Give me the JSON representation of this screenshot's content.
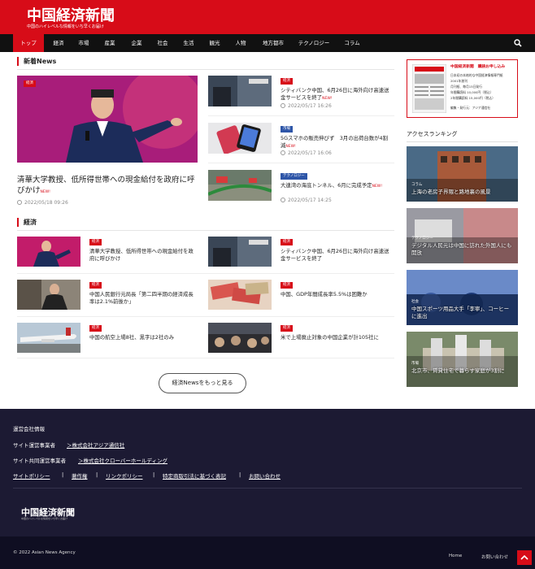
{
  "header": {
    "logo": "中国経済新聞",
    "tagline": "中国のハイレベルな情報をいち早くお届け"
  },
  "nav": {
    "items": [
      "トップ",
      "経済",
      "市場",
      "産業",
      "企業",
      "社会",
      "生活",
      "観光",
      "人物",
      "地方都市",
      "テクノロジー",
      "コラム"
    ],
    "active": "トップ"
  },
  "news": {
    "title": "新着News",
    "featured": {
      "badge": "経済",
      "title": "清華大学教授、低所得世帯への現金給付を政府に呼びかけ",
      "new": "NEW!",
      "date": "2022/05/18 09:26"
    },
    "items": [
      {
        "badge": "経済",
        "title": "シティバンク中国、6月26日に海外向け高速送金サービスを終了",
        "new": "NEW!",
        "date": "2022/05/17 16:26"
      },
      {
        "badge": "市場",
        "title": "5Gスマホの販売伸びず　3月の出荷台数が4割減",
        "new": "NEW!",
        "date": "2022/05/17 16:06"
      },
      {
        "badge": "テクノロジー",
        "title": "大連湾の海底トンネル、6月に完成予定",
        "new": "NEW!",
        "date": "2022/05/17 14:25"
      }
    ]
  },
  "economy": {
    "title": "経済",
    "items": [
      {
        "badge": "経済",
        "title": "清華大学教授、低所得世帯への現金給付を政府に呼びかけ"
      },
      {
        "badge": "経済",
        "title": "シティバンク中国、6月26日に海外向け高速送金サービスを終了"
      },
      {
        "badge": "経済",
        "title": "中国人民銀行元局長「第二四半期の経済成長率は2.1%前後か」"
      },
      {
        "badge": "経済",
        "title": "中国、GDP年間成長率5.5%は困難か"
      },
      {
        "badge": "経済",
        "title": "中国の航空上場8社、黒字は2社のみ"
      },
      {
        "badge": "経済",
        "title": "米で上場廃止対象の中国企業が計105社に"
      }
    ],
    "more_label": "経済Newsをもっと見る"
  },
  "sidebar": {
    "ad": {
      "title": "中国経済新聞　購読お申し込み",
      "lines": [
        "日本初の本格的な中国経済情報専門紙",
        "2001年創刊",
        "月刊紙、毎月15日発行",
        "年間購読料 10,000円（税込）",
        "2年間購読料 15,000円（税込）",
        "編集・発行元：アジア通信社"
      ]
    },
    "ranking_title": "アクセスランキング",
    "ranking": [
      {
        "cat": "コラム",
        "title": "上海の老房子界隈と路地裏の風景"
      },
      {
        "cat": "テクノロジー",
        "title": "デジタル人民元は中国に訪れた外国人にも開放"
      },
      {
        "cat": "社会",
        "title": "中国スポーツ用品大手「李寧」、コーヒーに進出"
      },
      {
        "cat": "市場",
        "title": "北京市、賃貸住宅で暮らす家庭が3割に"
      }
    ]
  },
  "footer": {
    "company_info": "運営会社情報",
    "operator_label": "サイト運営事業者",
    "operator_name": "＞株式会社アジア通信社",
    "co_operator_label": "サイト共同運営事業者",
    "co_operator_name": "＞株式会社クローバーホールディング",
    "links": [
      "サイトポリシー",
      "著作権",
      "リンクポリシー",
      "特定商取引法に基づく表記",
      "お問い合わせ"
    ],
    "logo": "中国経済新聞",
    "logo_tag": "中国のハイレベルな情報をいち早くお届け",
    "copyright": "© 2022 Asian News Agency",
    "bottom_links": [
      "Home",
      "お問い合わせ"
    ]
  }
}
